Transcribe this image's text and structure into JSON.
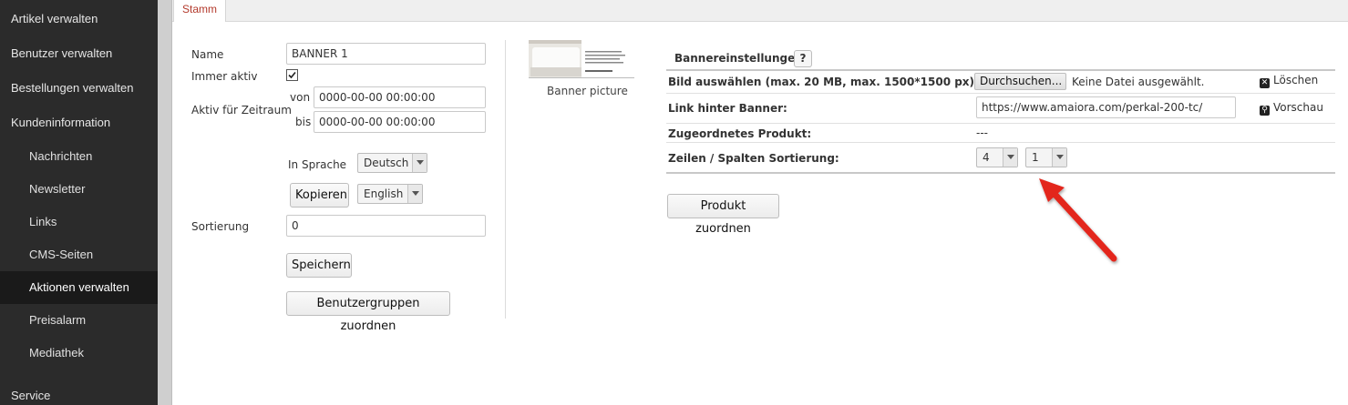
{
  "sidebar": {
    "items": [
      {
        "label": "Artikel verwalten"
      },
      {
        "label": "Benutzer verwalten"
      },
      {
        "label": "Bestellungen verwalten"
      },
      {
        "label": "Kundeninformation"
      },
      {
        "label": "Nachrichten"
      },
      {
        "label": "Newsletter"
      },
      {
        "label": "Links"
      },
      {
        "label": "CMS-Seiten"
      },
      {
        "label": "Aktionen verwalten"
      },
      {
        "label": "Preisalarm"
      },
      {
        "label": "Mediathek"
      },
      {
        "label": "Service"
      }
    ]
  },
  "tabs": {
    "stamm": "Stamm"
  },
  "form": {
    "name_label": "Name",
    "name_value": "BANNER 1",
    "immer_aktiv_label": "Immer aktiv",
    "immer_aktiv_checked": true,
    "zeitraum_label": "Aktiv für Zeitraum",
    "von_label": "von",
    "von_value": "0000-00-00 00:00:00",
    "bis_label": "bis",
    "bis_value": "0000-00-00 00:00:00",
    "sprache_label": "In Sprache",
    "sprache_value": "Deutsch",
    "kopieren_label": "Kopieren",
    "kopieren_lang": "English",
    "sortierung_label": "Sortierung",
    "sortierung_value": "0",
    "speichern_label": "Speichern",
    "gruppen_label": "Benutzergruppen zuordnen"
  },
  "banner": {
    "caption": "Banner picture"
  },
  "settings": {
    "title": "Bannereinstellungen",
    "help": "?",
    "bild_label": "Bild auswählen (max. 20 MB, max. 1500*1500 px):",
    "browse_label": "Durchsuchen...",
    "no_file": "Keine Datei ausgewählt.",
    "loeschen": "Löschen",
    "link_label": "Link hinter Banner:",
    "link_value": "https://www.amaiora.com/perkal-200-tc/",
    "vorschau": "Vorschau",
    "produkt_label": "Zugeordnetes Produkt:",
    "produkt_value": "---",
    "sort_label": "Zeilen / Spalten Sortierung:",
    "zeilen_value": "4",
    "spalten_value": "1",
    "zuordnen_label": "Produkt zuordnen"
  },
  "colors": {
    "sidebar_bg": "#2b2b2b",
    "tab_accent": "#b33a2c",
    "arrow": "#e3261e"
  }
}
